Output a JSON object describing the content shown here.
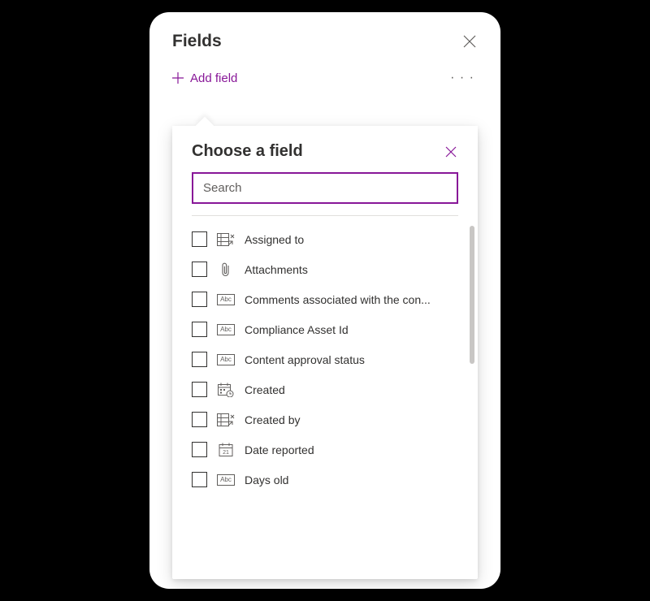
{
  "panel": {
    "title": "Fields",
    "add_field_label": "Add field"
  },
  "dropdown": {
    "title": "Choose a field",
    "search_placeholder": "Search",
    "fields": [
      {
        "label": "Assigned to",
        "icon": "person-table"
      },
      {
        "label": "Attachments",
        "icon": "attachment"
      },
      {
        "label": "Comments associated with the con...",
        "icon": "abc"
      },
      {
        "label": "Compliance Asset Id",
        "icon": "abc"
      },
      {
        "label": "Content approval status",
        "icon": "abc"
      },
      {
        "label": "Created",
        "icon": "calendar-clock"
      },
      {
        "label": "Created by",
        "icon": "person-table"
      },
      {
        "label": "Date reported",
        "icon": "calendar-date"
      },
      {
        "label": "Days old",
        "icon": "abc"
      }
    ]
  }
}
